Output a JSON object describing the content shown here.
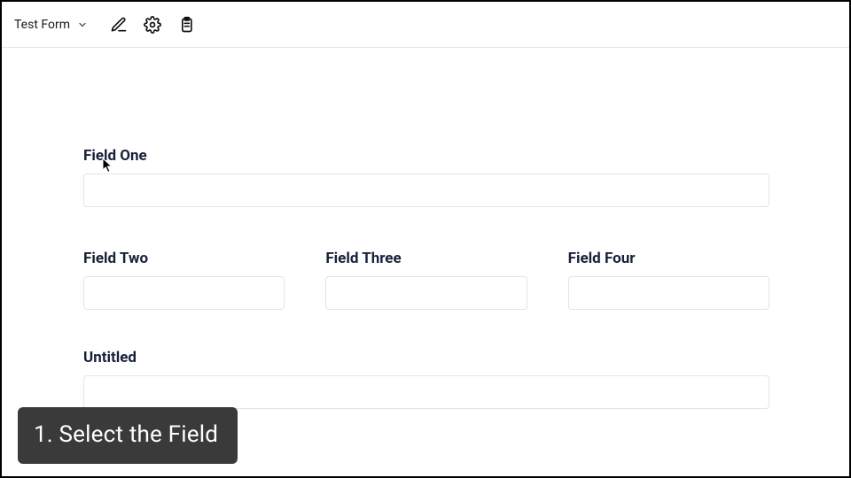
{
  "toolbar": {
    "title": "Test Form"
  },
  "fields": {
    "f1": {
      "label": "Field One",
      "value": ""
    },
    "f2": {
      "label": "Field Two",
      "value": ""
    },
    "f3": {
      "label": "Field Three",
      "value": ""
    },
    "f4": {
      "label": "Field Four",
      "value": ""
    },
    "f5": {
      "label": "Untitled",
      "value": ""
    }
  },
  "caption": "1. Select the Field"
}
